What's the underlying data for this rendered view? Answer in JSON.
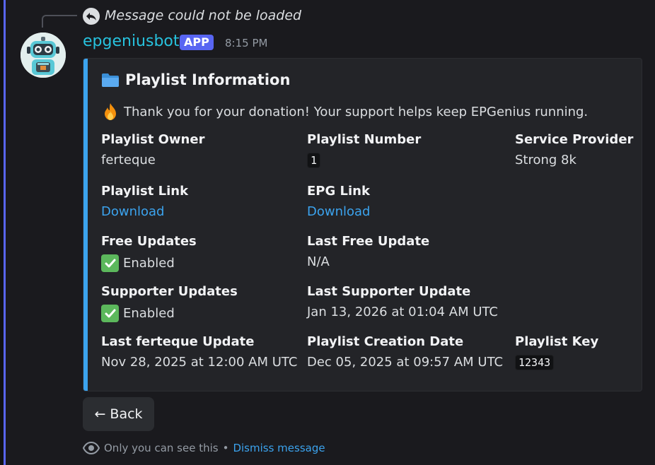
{
  "reply": {
    "text": "Message could not be loaded",
    "icon": "reply-arrow-icon"
  },
  "message": {
    "author": "epgeniusbot",
    "badge": "APP",
    "timestamp": "8:15 PM",
    "avatar_icon": "robot-avatar-icon",
    "author_color": "#27c2de",
    "badge_color": "#5865f2"
  },
  "embed": {
    "accent_color": "#3ba3ee",
    "title_icon": "folder-icon",
    "title": "Playlist Information",
    "description_icon": "fire-icon",
    "description": "Thank you for your donation! Your support helps keep EPGenius running.",
    "fields": {
      "playlist_owner": {
        "name": "Playlist Owner",
        "value": "ferteque"
      },
      "playlist_number": {
        "name": "Playlist Number",
        "value": "1"
      },
      "service_provider": {
        "name": "Service Provider",
        "value": "Strong 8k"
      },
      "playlist_link": {
        "name": "Playlist Link",
        "value": "Download"
      },
      "epg_link": {
        "name": "EPG Link",
        "value": "Download"
      },
      "free_updates": {
        "name": "Free Updates",
        "value": "Enabled",
        "icon": "check-mark-icon"
      },
      "last_free_update": {
        "name": "Last Free Update",
        "value": "N/A"
      },
      "supporter_updates": {
        "name": "Supporter Updates",
        "value": "Enabled",
        "icon": "check-mark-icon"
      },
      "last_supporter_update": {
        "name": "Last Supporter Update",
        "value": "Jan 13, 2026 at 01:04 AM UTC"
      },
      "last_owner_update": {
        "name": "Last ferteque Update",
        "value": "Nov 28, 2025 at 12:00 AM UTC"
      },
      "playlist_creation_date": {
        "name": "Playlist Creation Date",
        "value": "Dec 05, 2025 at 09:57 AM UTC"
      },
      "playlist_key": {
        "name": "Playlist Key",
        "value": "12343"
      }
    }
  },
  "buttons": {
    "back": "← Back"
  },
  "ephemeral": {
    "icon": "eye-icon",
    "text": "Only you can see this",
    "separator": "•",
    "dismiss": "Dismiss message"
  }
}
